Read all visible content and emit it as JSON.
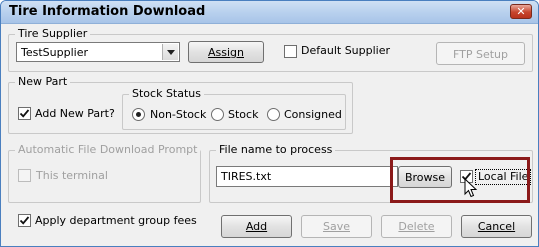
{
  "window": {
    "title": "Tire Information Download",
    "close_label": "✕"
  },
  "tire_supplier": {
    "legend": "Tire Supplier",
    "selected": "TestSupplier",
    "assign_label": "Assign",
    "default_supplier_label": "Default Supplier",
    "ftp_setup_label": "FTP Setup"
  },
  "new_part": {
    "legend": "New Part",
    "add_new_part_label": "Add New Part?",
    "add_new_part_checked": true,
    "stock_status": {
      "legend": "Stock Status",
      "options": [
        "Non-Stock",
        "Stock",
        "Consigned"
      ],
      "selected": "Non-Stock"
    }
  },
  "auto_download": {
    "legend": "Automatic File Download Prompt",
    "this_terminal_label": "This terminal"
  },
  "file_to_process": {
    "legend": "File name to process",
    "value": "TIRES.txt",
    "browse_label": "Browse",
    "local_file_label": "Local File",
    "local_file_checked": true
  },
  "apply_fees": {
    "label": "Apply department group fees",
    "checked": true
  },
  "actions": {
    "add": "Add",
    "save": "Save",
    "delete": "Delete",
    "cancel": "Cancel"
  },
  "colors": {
    "highlight": "#8b1a1a"
  }
}
